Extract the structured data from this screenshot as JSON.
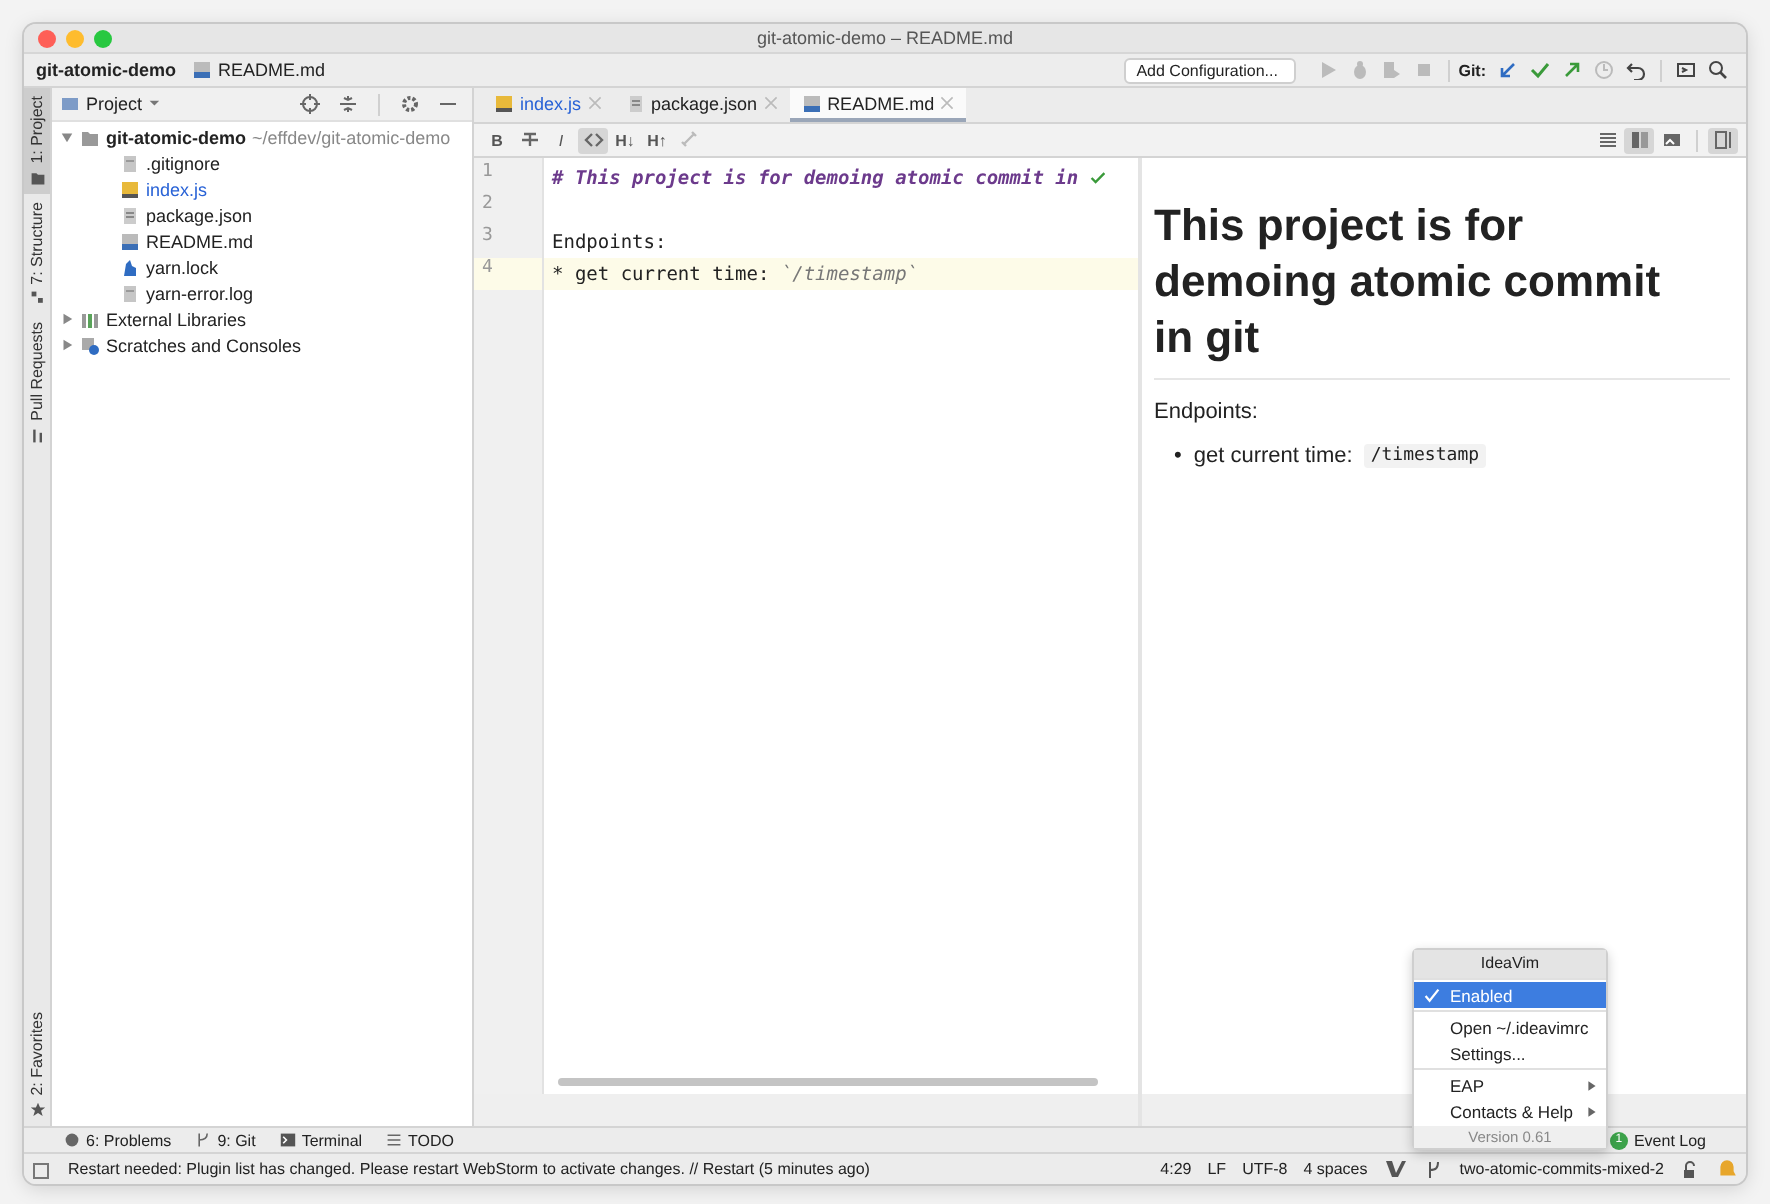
{
  "window": {
    "title": "git-atomic-demo – README.md"
  },
  "breadcrumb": [
    {
      "label": "git-atomic-demo",
      "kind": "project"
    },
    {
      "label": "README.md",
      "kind": "md"
    }
  ],
  "toolbar": {
    "run_config": "Add Configuration...",
    "git_label": "Git:"
  },
  "left_strip": [
    {
      "label": "1: Project",
      "selected": true,
      "kind": "folder"
    },
    {
      "label": "7: Structure",
      "selected": false,
      "kind": "structure"
    },
    {
      "label": "Pull Requests",
      "selected": false,
      "kind": "pull"
    }
  ],
  "left_strip_bottom": [
    {
      "label": "2: Favorites",
      "selected": false,
      "kind": "star"
    }
  ],
  "project_panel": {
    "title": "Project",
    "tree": [
      {
        "label": "git-atomic-demo",
        "path": "~/effdev/git-atomic-demo",
        "kind": "folder",
        "expanded": true,
        "added": false,
        "children": [
          {
            "label": ".gitignore",
            "kind": "doc",
            "added": false
          },
          {
            "label": "index.js",
            "kind": "js",
            "added": true
          },
          {
            "label": "package.json",
            "kind": "json",
            "added": false
          },
          {
            "label": "README.md",
            "kind": "md",
            "added": false
          },
          {
            "label": "yarn.lock",
            "kind": "yarn",
            "added": false
          },
          {
            "label": "yarn-error.log",
            "kind": "doc",
            "added": false
          }
        ]
      },
      {
        "label": "External Libraries",
        "kind": "library",
        "expanded": false,
        "added": false
      },
      {
        "label": "Scratches and Consoles",
        "kind": "scratch",
        "expanded": false,
        "added": false
      }
    ]
  },
  "editor_tabs": [
    {
      "label": "index.js",
      "kind": "js",
      "selected": false,
      "added": true
    },
    {
      "label": "package.json",
      "kind": "json",
      "selected": false,
      "added": false
    },
    {
      "label": "README.md",
      "kind": "md",
      "selected": true,
      "added": false
    }
  ],
  "format_buttons": [
    {
      "kind": "bold",
      "label": "B",
      "selected": false
    },
    {
      "kind": "strike",
      "selected": false
    },
    {
      "kind": "italic",
      "label": "I",
      "selected": false
    },
    {
      "kind": "code",
      "selected": true
    },
    {
      "kind": "heading",
      "label": "H↓",
      "selected": false
    },
    {
      "kind": "heading",
      "label": "H↑",
      "selected": false
    },
    {
      "kind": "link",
      "selected": false
    }
  ],
  "view_buttons": [
    {
      "kind": "editor",
      "selected": false
    },
    {
      "kind": "split",
      "selected": true
    },
    {
      "kind": "preview",
      "selected": false
    },
    {
      "kind": "scroll-sync",
      "selected": true
    }
  ],
  "code_lines": [
    {
      "number": "1",
      "kind": "heading",
      "text": "# This project is for demoing atomic commit in",
      "current": false
    },
    {
      "number": "2",
      "kind": "blank",
      "current": false
    },
    {
      "number": "3",
      "kind": "text",
      "text": "Endpoints:",
      "current": false
    },
    {
      "number": "4",
      "kind": "list",
      "text": "* get current time: ",
      "code": "`/timestamp`",
      "current": true
    }
  ],
  "preview": {
    "heading": "This project is for demoing atomic commit in git",
    "paragraph": "Endpoints:",
    "list": [
      {
        "marker": "•",
        "text": "get current time: ",
        "code": "/timestamp"
      }
    ]
  },
  "bottom_tools": [
    {
      "label": "6: Problems",
      "kind": "problems"
    },
    {
      "label": "9: Git",
      "kind": "branch"
    },
    {
      "label": "Terminal",
      "kind": "terminal"
    },
    {
      "label": "TODO",
      "kind": "list"
    }
  ],
  "event_log": {
    "label": "Event Log",
    "count": "1"
  },
  "status_bar": {
    "message": "Restart needed: Plugin list has changed. Please restart WebStorm to activate changes. // Restart (5 minutes ago)",
    "items": [
      "4:29",
      "LF",
      "UTF-8",
      "4 spaces"
    ],
    "branch": "two-atomic-commits-mixed-2"
  },
  "popup": {
    "title": "IdeaVim",
    "sections": [
      [
        {
          "label": "Enabled",
          "checked": true,
          "selected": true,
          "submenu": false
        }
      ],
      [
        {
          "label": "Open ~/.ideavimrc",
          "checked": false,
          "selected": false,
          "submenu": false
        },
        {
          "label": "Settings...",
          "checked": false,
          "selected": false,
          "submenu": false
        }
      ],
      [
        {
          "label": "EAP",
          "checked": false,
          "selected": false,
          "submenu": true
        },
        {
          "label": "Contacts & Help",
          "checked": false,
          "selected": false,
          "submenu": true
        }
      ]
    ],
    "footer": "Version 0.61"
  }
}
